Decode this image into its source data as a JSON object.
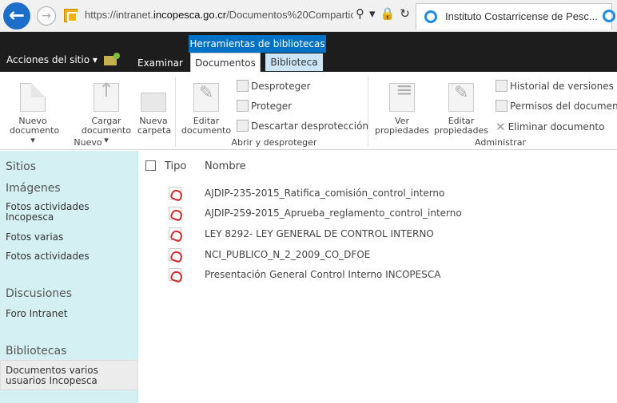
{
  "browser": {
    "url_prefix": "https://intranet.",
    "url_domain": "incopesca.go.cr",
    "url_rest": "/Documentos%20Compartic",
    "tab_title": "Instituto Costarricense de Pesc..."
  },
  "ribbon": {
    "context_group": "Herramientas de bibliotecas",
    "site_actions": "Acciones del sitio ▾",
    "tab_examinar": "Examinar",
    "tab_documentos": "Documentos",
    "tab_biblioteca": "Biblioteca",
    "nuevo": {
      "new_doc": [
        "Nuevo",
        "documento ▾"
      ],
      "upload": [
        "Cargar",
        "documento ▾"
      ],
      "new_folder": [
        "Nueva",
        "carpeta"
      ],
      "label": "Nuevo"
    },
    "abrir": {
      "edit": [
        "Editar",
        "documento"
      ],
      "checkin": "Desproteger",
      "checkout": "Proteger",
      "discard": "Descartar desprotección",
      "label": "Abrir y desproteger"
    },
    "admin": {
      "view_props": [
        "Ver",
        "propiedades"
      ],
      "edit_props": [
        "Editar",
        "propiedades"
      ],
      "history": "Historial de versiones",
      "perms": "Permisos del documento",
      "delete": "Eliminar documento",
      "label": "Administrar"
    }
  },
  "nav": {
    "sitios": "Sitios",
    "imagenes": "Imágenes",
    "fotos_actividades_incopesca": [
      "Fotos actividades",
      "Incopesca"
    ],
    "fotos_varias": "Fotos varias",
    "fotos_actividades": "Fotos actividades",
    "discusiones": "Discusiones",
    "foro": "Foro Intranet",
    "bibliotecas": "Bibliotecas",
    "docs_varios": [
      "Documentos varios",
      "usuarios Incopesca"
    ]
  },
  "list": {
    "col_tipo": "Tipo",
    "col_nombre": "Nombre",
    "items": [
      "AJDIP-235-2015_Ratifica_comisión_control_interno",
      "AJDIP-259-2015_Aprueba_reglamento_control_interno",
      "LEY 8292- LEY GENERAL DE CONTROL INTERNO",
      "NCI_PUBLICO_N_2_2009_CO_DFOE",
      "Presentación General Control Interno INCOPESCA"
    ]
  }
}
